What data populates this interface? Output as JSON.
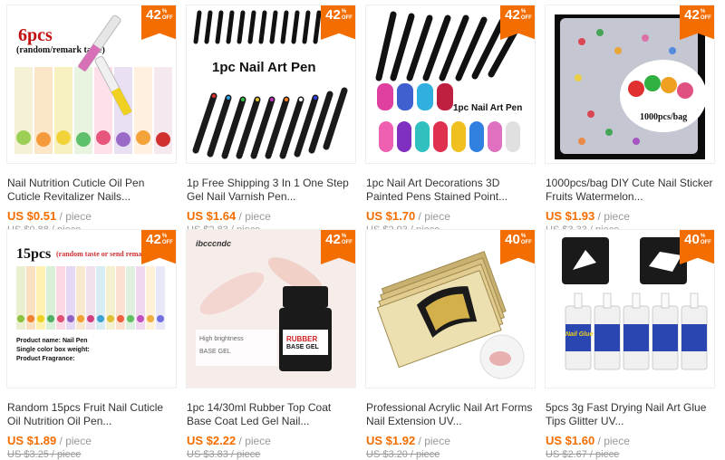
{
  "products": [
    {
      "discount": "42",
      "pct_sign": "%",
      "off": "OFF",
      "title": "Nail Nutrition Cuticle Oil Pen Cuticle Revitalizer Nails...",
      "price_now": "US $0.51",
      "per": "/ piece",
      "price_old": "US $0.88 / piece",
      "img_text": "6pcs",
      "img_sub": "(random/remark taste)"
    },
    {
      "discount": "42",
      "pct_sign": "%",
      "off": "OFF",
      "title": "1p Free Shipping 3 In 1 One Step Gel Nail Varnish Pen...",
      "price_now": "US $1.64",
      "per": "/ piece",
      "price_old": "US $2.83 / piece",
      "img_text": "1pc Nail Art Pen"
    },
    {
      "discount": "42",
      "pct_sign": "%",
      "off": "OFF",
      "title": "1pc Nail Art Decorations 3D Painted Pens Stained Point...",
      "price_now": "US $1.70",
      "per": "/ piece",
      "price_old": "US $2.93 / piece",
      "img_text": "1pc Nail Art Pen"
    },
    {
      "discount": "42",
      "pct_sign": "%",
      "off": "OFF",
      "title": "1000pcs/bag DIY Cute Nail Sticker Fruits Watermelon...",
      "price_now": "US $1.93",
      "per": "/ piece",
      "price_old": "US $3.33 / piece",
      "img_text": "1000pcs/bag"
    },
    {
      "discount": "42",
      "pct_sign": "%",
      "off": "OFF",
      "title": "Random 15pcs Fruit Nail Cuticle Oil Nutrition Oil Pen...",
      "price_now": "US $1.89",
      "per": "/ piece",
      "price_old": "US $3.25 / piece",
      "img_text": "15pcs",
      "img_sub": "(random taste or send remark)",
      "img_lines": [
        "Product name: Nail Pen",
        "Single color box weight:",
        "Product Fragrance:"
      ]
    },
    {
      "discount": "42",
      "pct_sign": "%",
      "off": "OFF",
      "title": "1pc 14/30ml Rubber Top Coat Base Coat Led Gel Nail...",
      "price_now": "US $2.22",
      "per": "/ piece",
      "price_old": "US $3.83 / piece",
      "img_brand": "ibcccndc",
      "img_text": "RUBBER",
      "img_sub": "BASE GEL",
      "img_lines": [
        "High brightness",
        "BASE GEL"
      ]
    },
    {
      "discount": "40",
      "pct_sign": "%",
      "off": "OFF",
      "title": "Professional Acrylic Nail Art Forms Nail Extension UV...",
      "price_now": "US $1.92",
      "per": "/ piece",
      "price_old": "US $3.20 / piece"
    },
    {
      "discount": "40",
      "pct_sign": "%",
      "off": "OFF",
      "title": "5pcs 3g Fast Drying Nail Art Glue Tips Glitter UV...",
      "price_now": "US $1.60",
      "per": "/ piece",
      "price_old": "US $2.67 / piece",
      "img_text": "Nail Glue"
    }
  ]
}
